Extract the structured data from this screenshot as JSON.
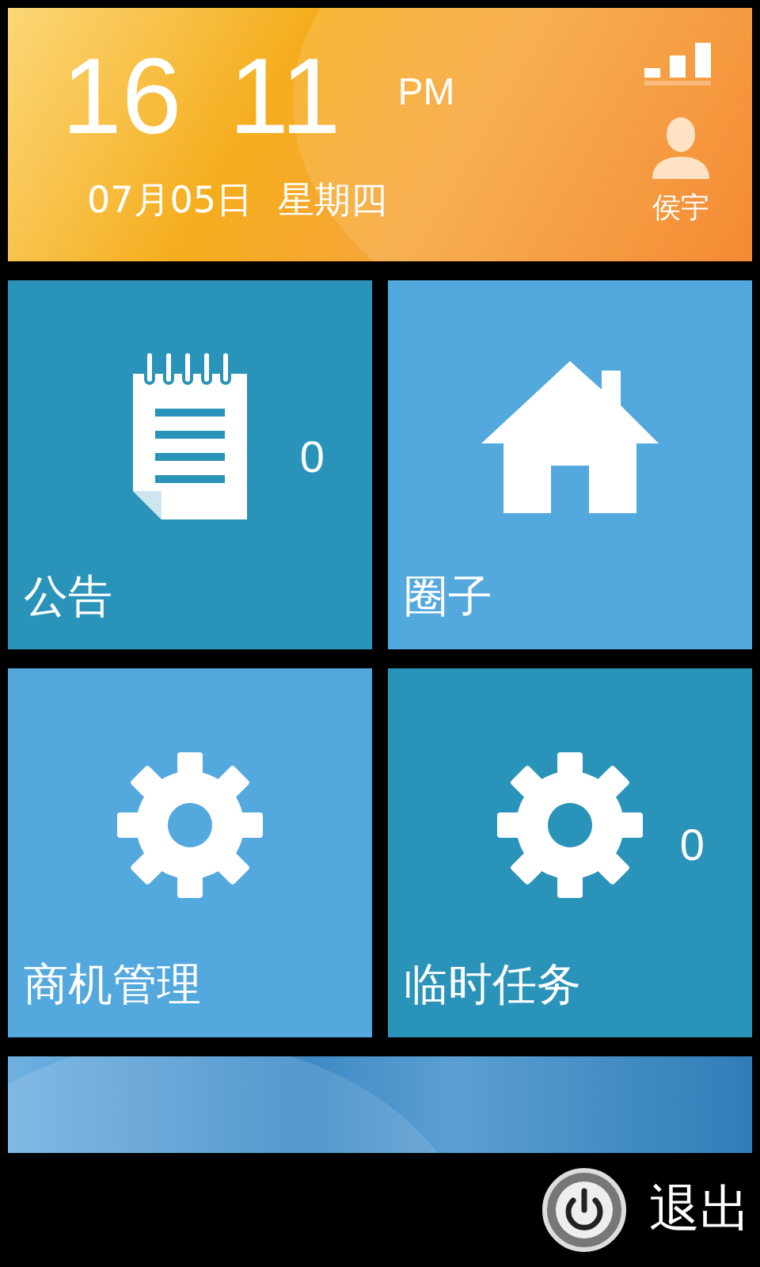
{
  "header": {
    "hour": "16",
    "minute": "11",
    "ampm": "PM",
    "date": "07月05日",
    "weekday": "星期四",
    "user": "侯宇"
  },
  "tiles": [
    {
      "label": "公告",
      "kind": "notes",
      "count": "0",
      "color": "#2a93b9"
    },
    {
      "label": "圈子",
      "kind": "home",
      "color": "#53a8de"
    },
    {
      "label": "商机管理",
      "kind": "gear",
      "color": "#53a8de"
    },
    {
      "label": "临时任务",
      "kind": "gear",
      "count": "0",
      "color": "#2a93b9"
    }
  ],
  "footer": {
    "exit": "退出"
  }
}
